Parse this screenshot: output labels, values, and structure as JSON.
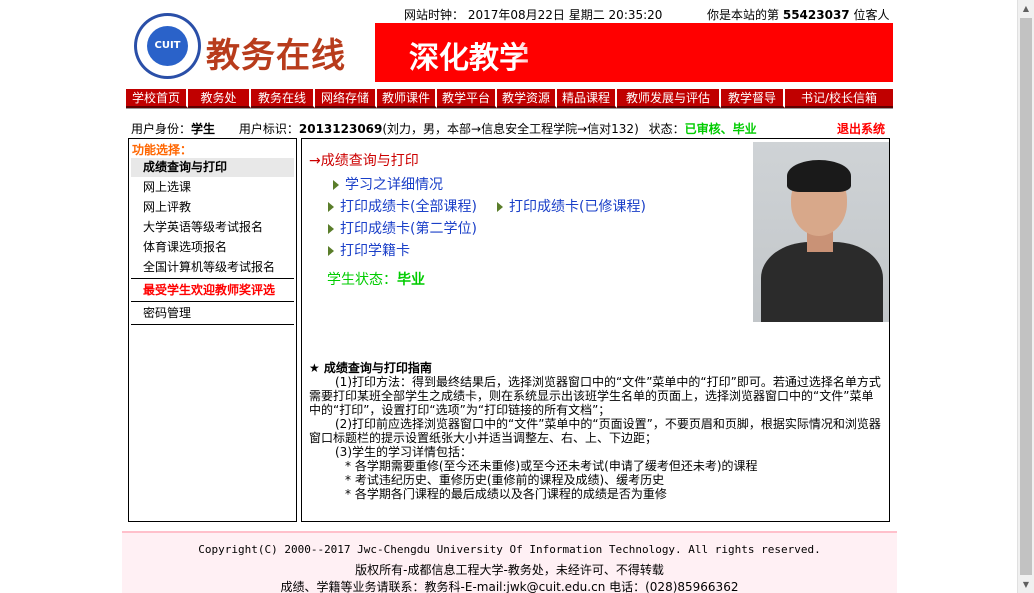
{
  "header": {
    "site_time_label": "网站时钟：",
    "datetime": "2017年08月22日 星期二 20:35:20",
    "visitor_prefix": "你是本站的第",
    "visitor_count": "55423037",
    "visitor_suffix": "位客人",
    "logo_text": "CUIT",
    "site_title": "教务在线",
    "banner_text": "深化教学"
  },
  "nav": {
    "items": [
      "学校首页",
      "教务处",
      "教务在线",
      "网络存储",
      "教师课件",
      "教学平台",
      "教学资源",
      "精品课程",
      "教师发展与评估",
      "教学督导",
      "书记/校长信箱"
    ]
  },
  "user": {
    "identity_label": "用户身份：",
    "identity": "学生",
    "id_label": "用户标识：",
    "id_number": "2013123069",
    "id_detail": "(刘力，男，本部→信息安全工程学院→信对132)",
    "state_label": "状态：",
    "state": "已审核、毕业",
    "logout": "退出系统"
  },
  "sidebar": {
    "title": "功能选择：",
    "items": [
      "成绩查询与打印",
      "网上选课",
      "网上评教",
      "大学英语等级考试报名",
      "体育课选项报名",
      "全国计算机等级考试报名"
    ],
    "highlight": "最受学生欢迎教师奖评选",
    "password": "密码管理"
  },
  "main": {
    "current": "→成绩查询与打印",
    "links": {
      "study_detail": "学习之详细情况",
      "print_all": "打印成绩卡(全部课程)",
      "print_done": "打印成绩卡(已修课程)",
      "print_second": "打印成绩卡(第二学位)",
      "print_register": "打印学籍卡"
    },
    "status_label": "学生状态：",
    "status_value": "毕业",
    "guide": {
      "title": "★ 成绩查询与打印指南",
      "p1": "(1)打印方法：得到最终结果后，选择浏览器窗口中的“文件”菜单中的“打印”即可。若通过选择名单方式需要打印某班全部学生之成绩卡，则在系统显示出该班学生名单的页面上，选择浏览器窗口中的“文件”菜单中的“打印”，设置打印“选项”为“打印链接的所有文档”；",
      "p2": "(2)打印前应选择浏览器窗口中的“文件”菜单中的“页面设置”，不要页眉和页脚，根据实际情况和浏览器窗口标题栏的提示设置纸张大小并适当调整左、右、上、下边距；",
      "p3": "(3)学生的学习详情包括：",
      "b1": "* 各学期需要重修(至今还未重修)或至今还未考试(申请了缓考但还未考)的课程",
      "b2": "* 考试违纪历史、重修历史(重修前的课程及成绩)、缓考历史",
      "b3": "* 各学期各门课程的最后成绩以及各门课程的成绩是否为重修"
    }
  },
  "footer": {
    "copyright": "Copyright(C) 2000--2017 Jwc-Chengdu University Of Information Technology. All rights reserved.",
    "rights": "版权所有-成都信息工程大学-教务处，未经许可、不得转载",
    "contact": "成绩、学籍等业务请联系：教务科-E-mail:jwk@cuit.edu.cn     电话：(028)85966362"
  },
  "colors": {
    "nav_bg": "#c00000",
    "banner_bg": "#ff0000",
    "link": "#1a3fc8",
    "status_green": "#00cc00"
  }
}
